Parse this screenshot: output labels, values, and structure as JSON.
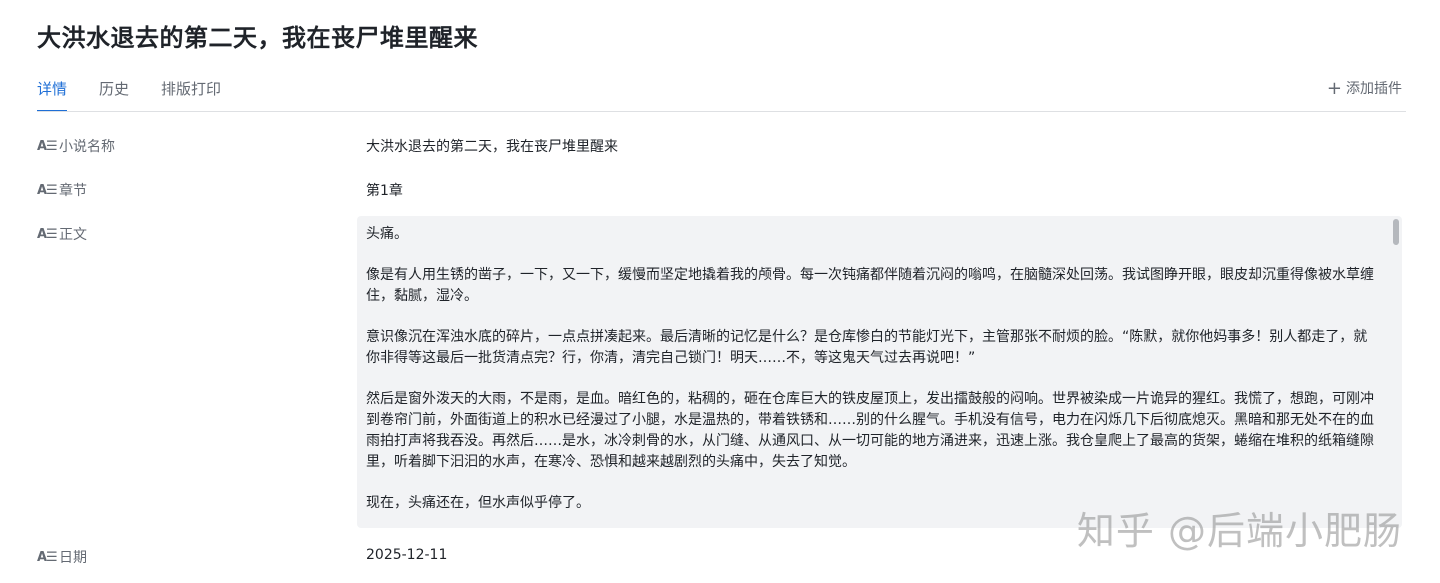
{
  "title": "大洪水退去的第二天，我在丧尸堆里醒来",
  "tabs": [
    {
      "label": "详情",
      "active": true
    },
    {
      "label": "历史",
      "active": false
    },
    {
      "label": "排版打印",
      "active": false
    }
  ],
  "add_plugin": {
    "icon": "+",
    "label": "添加插件"
  },
  "field_icon_glyph": "A☰",
  "fields": {
    "novel_name": {
      "label": "小说名称",
      "value": "大洪水退去的第二天，我在丧尸堆里醒来"
    },
    "chapter": {
      "label": "章节",
      "value": "第1章"
    },
    "body": {
      "label": "正文",
      "paragraphs": [
        "头痛。",
        "像是有人用生锈的凿子，一下，又一下，缓慢而坚定地撬着我的颅骨。每一次钝痛都伴随着沉闷的嗡鸣，在脑髓深处回荡。我试图睁开眼，眼皮却沉重得像被水草缠住，黏腻，湿冷。",
        "意识像沉在浑浊水底的碎片，一点点拼凑起来。最后清晰的记忆是什么？是仓库惨白的节能灯光下，主管那张不耐烦的脸。“陈默，就你他妈事多！别人都走了，就你非得等这最后一批货清点完？行，你清，清完自己锁门！明天……不，等这鬼天气过去再说吧！”",
        "然后是窗外泼天的大雨，不是雨，是血。暗红色的，粘稠的，砸在仓库巨大的铁皮屋顶上，发出擂鼓般的闷响。世界被染成一片诡异的猩红。我慌了，想跑，可刚冲到卷帘门前，外面街道上的积水已经漫过了小腿，水是温热的，带着铁锈和……别的什么腥气。手机没有信号，电力在闪烁几下后彻底熄灭。黑暗和那无处不在的血雨拍打声将我吞没。再然后……是水，冰冷刺骨的水，从门缝、从通风口、从一切可能的地方涌进来，迅速上涨。我仓皇爬上了最高的货架，蜷缩在堆积的纸箱缝隙里，听着脚下汩汩的水声，在寒冷、恐惧和越来越剧烈的头痛中，失去了知觉。",
        "现在，头痛还在，但水声似乎停了。"
      ]
    },
    "date": {
      "label": "日期",
      "value": "2025-12-11"
    }
  },
  "watermark": "知乎 @后端小肥肠"
}
